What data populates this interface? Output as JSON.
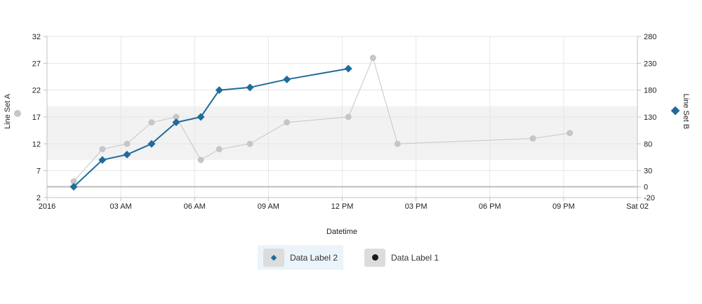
{
  "chart_data": {
    "type": "line",
    "xlabel": "Datetime",
    "ylabel_left": "Line Set A",
    "ylabel_right": "Line Set B",
    "x_range": [
      "2016-01-01 00:00",
      "2016-01-02 00:00"
    ],
    "x_ticks": [
      {
        "t": "2016-01-01 00:00",
        "label": "2016"
      },
      {
        "t": "2016-01-01 03:00",
        "label": "03 AM"
      },
      {
        "t": "2016-01-01 06:00",
        "label": "06 AM"
      },
      {
        "t": "2016-01-01 09:00",
        "label": "09 AM"
      },
      {
        "t": "2016-01-01 12:00",
        "label": "12 PM"
      },
      {
        "t": "2016-01-01 15:00",
        "label": "03 PM"
      },
      {
        "t": "2016-01-01 18:00",
        "label": "06 PM"
      },
      {
        "t": "2016-01-01 21:00",
        "label": "09 PM"
      },
      {
        "t": "2016-01-02 00:00",
        "label": "Sat 02"
      }
    ],
    "y_left": {
      "min": 2,
      "max": 32,
      "ticks": [
        2,
        7,
        12,
        17,
        22,
        27,
        32
      ]
    },
    "y_right": {
      "min": -20,
      "max": 280,
      "ticks": [
        -20,
        0,
        30,
        80,
        130,
        180,
        230,
        280
      ]
    },
    "band_left": [
      9,
      19
    ],
    "reference_line_right": 0,
    "grid": true,
    "series": [
      {
        "name": "Data Label 2",
        "axis": "right",
        "marker": "diamond",
        "color": "#1f6b9c",
        "points": [
          {
            "t": "2016-01-01 01:05",
            "y": 0
          },
          {
            "t": "2016-01-01 02:15",
            "y": 50
          },
          {
            "t": "2016-01-01 03:15",
            "y": 60
          },
          {
            "t": "2016-01-01 04:15",
            "y": 80
          },
          {
            "t": "2016-01-01 05:15",
            "y": 120
          },
          {
            "t": "2016-01-01 06:15",
            "y": 130
          },
          {
            "t": "2016-01-01 07:00",
            "y": 180
          },
          {
            "t": "2016-01-01 08:15",
            "y": 185
          },
          {
            "t": "2016-01-01 09:45",
            "y": 200
          },
          {
            "t": "2016-01-01 12:15",
            "y": 220
          }
        ]
      },
      {
        "name": "Data Label 1",
        "axis": "left",
        "marker": "circle",
        "color": "#c6c6c6",
        "points": [
          {
            "t": "2016-01-01 01:05",
            "y": 5
          },
          {
            "t": "2016-01-01 02:15",
            "y": 11
          },
          {
            "t": "2016-01-01 03:15",
            "y": 12
          },
          {
            "t": "2016-01-01 04:15",
            "y": 16
          },
          {
            "t": "2016-01-01 05:15",
            "y": 17
          },
          {
            "t": "2016-01-01 06:15",
            "y": 9
          },
          {
            "t": "2016-01-01 07:00",
            "y": 11
          },
          {
            "t": "2016-01-01 08:15",
            "y": 12
          },
          {
            "t": "2016-01-01 09:45",
            "y": 16
          },
          {
            "t": "2016-01-01 12:15",
            "y": 17
          },
          {
            "t": "2016-01-01 13:15",
            "y": 28
          },
          {
            "t": "2016-01-01 14:15",
            "y": 12
          },
          {
            "t": "2016-01-01 19:45",
            "y": 13
          },
          {
            "t": "2016-01-01 21:15",
            "y": 14
          }
        ]
      }
    ]
  },
  "legend": {
    "items": [
      {
        "label": "Data Label 2",
        "marker": "diamond",
        "color": "#1f6b9c",
        "active": true
      },
      {
        "label": "Data Label 1",
        "marker": "circle",
        "color": "#1a1a1a",
        "active": false
      }
    ]
  }
}
